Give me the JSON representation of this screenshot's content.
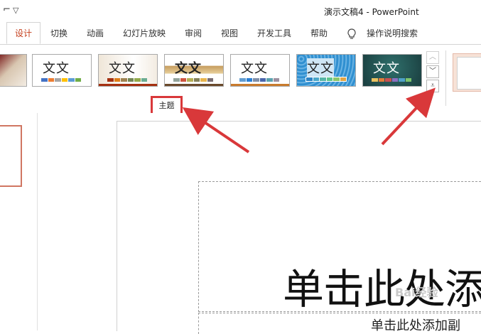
{
  "titlebar": {
    "title": "演示文稿4  -  PowerPoint",
    "quick_access_icon": "customize-quick-access-icon"
  },
  "tabs": [
    {
      "label": "设计",
      "active": true
    },
    {
      "label": "切换"
    },
    {
      "label": "动画"
    },
    {
      "label": "幻灯片放映"
    },
    {
      "label": "审阅"
    },
    {
      "label": "视图"
    },
    {
      "label": "开发工具"
    },
    {
      "label": "帮助"
    },
    {
      "label": "操作说明搜索",
      "icon": "lightbulb-icon"
    }
  ],
  "ribbon": {
    "group_label": "主题",
    "theme_sample_text": "文文",
    "theme_sample_text_alt": "文文",
    "themes": [
      {
        "name": "partial-theme"
      },
      {
        "name": "theme-1"
      },
      {
        "name": "theme-2"
      },
      {
        "name": "theme-3"
      },
      {
        "name": "theme-4"
      },
      {
        "name": "theme-5"
      },
      {
        "name": "theme-6"
      }
    ],
    "scroll_up_icon": "chevron-up-icon",
    "scroll_down_icon": "chevron-down-icon",
    "more_icon": "more-icon"
  },
  "slide": {
    "title_placeholder": "单击此处添",
    "subtitle_placeholder": "单击此处添加副"
  },
  "colors": {
    "accent": "#c43e1c",
    "highlight_box": "#d9383a",
    "arrow": "#d9383a"
  },
  "watermark": "Bai经验"
}
